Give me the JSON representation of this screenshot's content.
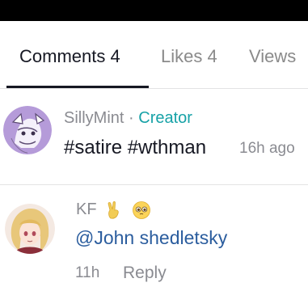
{
  "tabs": [
    {
      "label": "Comments 4",
      "active": true
    },
    {
      "label": "Likes 4",
      "active": false
    },
    {
      "label": "Views",
      "active": false
    }
  ],
  "comments": [
    {
      "username": "SillyMint",
      "separator": "·",
      "role": "Creator",
      "text": "#satire #wthman",
      "time": "16h ago",
      "avatar_icon": "purple-sketch-avatar-icon"
    },
    {
      "username": "KF",
      "emojis": [
        "victory-hand-emoji-icon",
        "pleading-face-emoji-icon"
      ],
      "mention": "@John shedletsky",
      "time": "11h",
      "reply_label": "Reply",
      "avatar_icon": "anime-girl-avatar-icon"
    }
  ],
  "colors": {
    "text_primary": "#161823",
    "text_secondary": "#8a8b91",
    "creator_accent": "#17a2a7",
    "mention": "#2b5d9e",
    "divider": "#e3e3e4",
    "top_bar": "#000000"
  }
}
